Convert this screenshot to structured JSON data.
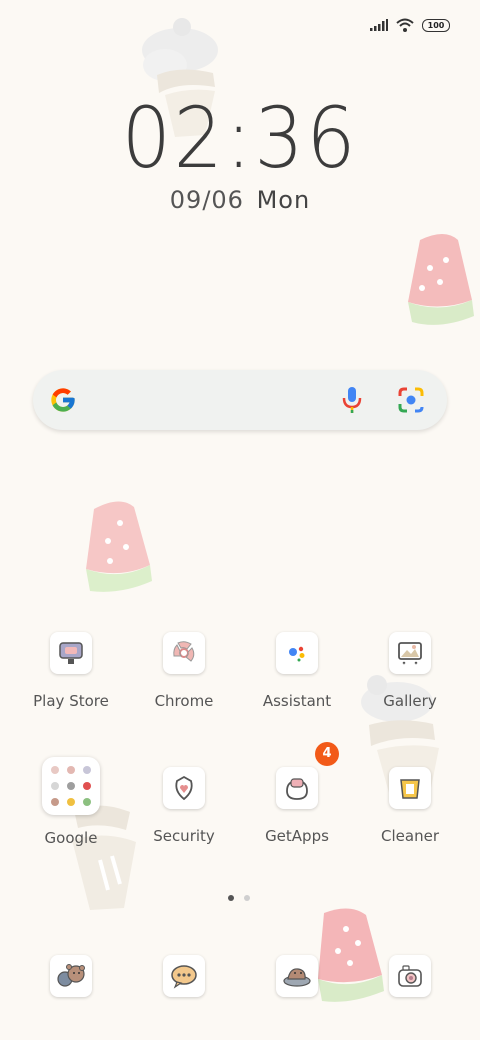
{
  "status": {
    "battery": "100",
    "signal_icon": "signal-icon",
    "wifi_icon": "wifi-icon"
  },
  "clock": {
    "time": "02:36",
    "date": "09/06",
    "day": "Mon"
  },
  "search": {
    "logo_icon": "google-g-icon",
    "mic_icon": "mic-icon",
    "lens_icon": "lens-icon"
  },
  "apps_row1": [
    {
      "label": "Play Store",
      "icon": "play-store-icon"
    },
    {
      "label": "Chrome",
      "icon": "chrome-icon"
    },
    {
      "label": "Assistant",
      "icon": "assistant-icon"
    },
    {
      "label": "Gallery",
      "icon": "gallery-icon"
    }
  ],
  "apps_row2": [
    {
      "label": "Google",
      "icon": "google-folder"
    },
    {
      "label": "Security",
      "icon": "security-icon"
    },
    {
      "label": "GetApps",
      "icon": "getapps-icon",
      "badge": "4"
    },
    {
      "label": "Cleaner",
      "icon": "cleaner-icon"
    }
  ],
  "dock": [
    {
      "icon": "phone-icon"
    },
    {
      "icon": "messages-icon"
    },
    {
      "icon": "browser-icon"
    },
    {
      "icon": "camera-icon"
    }
  ],
  "pages": {
    "count": 2,
    "active": 1
  },
  "colors": {
    "background": "#fcf9f4",
    "badge": "#f25a18",
    "watermelon": "#f4b6b8"
  }
}
